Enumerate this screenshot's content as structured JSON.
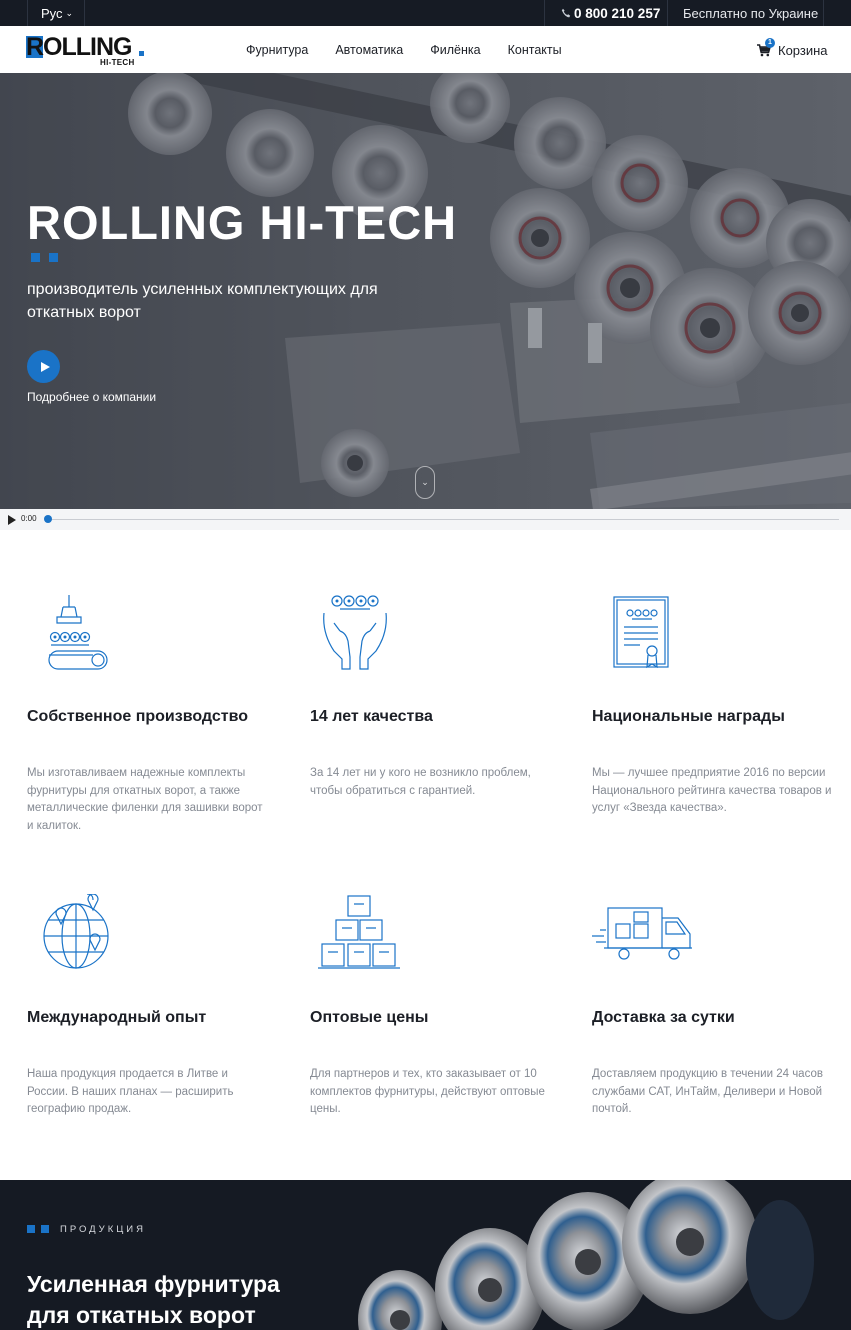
{
  "topbar": {
    "language": "Рус",
    "phone": "0 800 210 257",
    "phone_note": "Бесплатно по Украине"
  },
  "brand": {
    "logo_main": "ROLLING",
    "logo_sub": "HI-TECH"
  },
  "nav": {
    "items": [
      "Фурнитура",
      "Автоматика",
      "Филёнка",
      "Контакты"
    ],
    "cart_label": "Корзина",
    "cart_count": "1"
  },
  "hero": {
    "title": "ROLLING HI-TECH",
    "subtitle": "производитель усиленных комплектующих для откатных ворот",
    "more_label": "Подробнее о компании"
  },
  "audio": {
    "time": "0:00"
  },
  "features": [
    {
      "icon": "production-icon",
      "title": "Собственное производство",
      "text": "Мы изготавливаем надежные комплекты фурнитуры для откатных ворот, а также металлические филенки для зашивки ворот и калиток."
    },
    {
      "icon": "quality-hands-icon",
      "title": "14 лет качества",
      "text": "За 14 лет ни у кого не возникло проблем, чтобы обратиться с гарантией."
    },
    {
      "icon": "certificate-icon",
      "title": "Национальные награды",
      "text": "Мы — лучшее предприятие 2016 по версии Национального рейтинга качества товаров и услуг «Звезда качества»."
    },
    {
      "icon": "globe-icon",
      "title": "Международный опыт",
      "text": "Наша продукция продается в Литве и России. В наших планах — расширить географию продаж."
    },
    {
      "icon": "boxes-icon",
      "title": "Оптовые цены",
      "text": "Для партнеров и тех, кто заказывает от 10 комплектов фурнитуры, действуют оптовые цены."
    },
    {
      "icon": "truck-icon",
      "title": "Доставка за сутки",
      "text": "Доставляем продукцию в течении 24 часов службами САТ, ИнТайм, Деливери и Новой почтой."
    }
  ],
  "products": {
    "label": "ПРОДУКЦИЯ",
    "title": "Усиленная фурнитура для откатных ворот"
  },
  "colors": {
    "accent": "#1a73c7",
    "dark": "#151a23",
    "muted_text": "#858a93"
  }
}
